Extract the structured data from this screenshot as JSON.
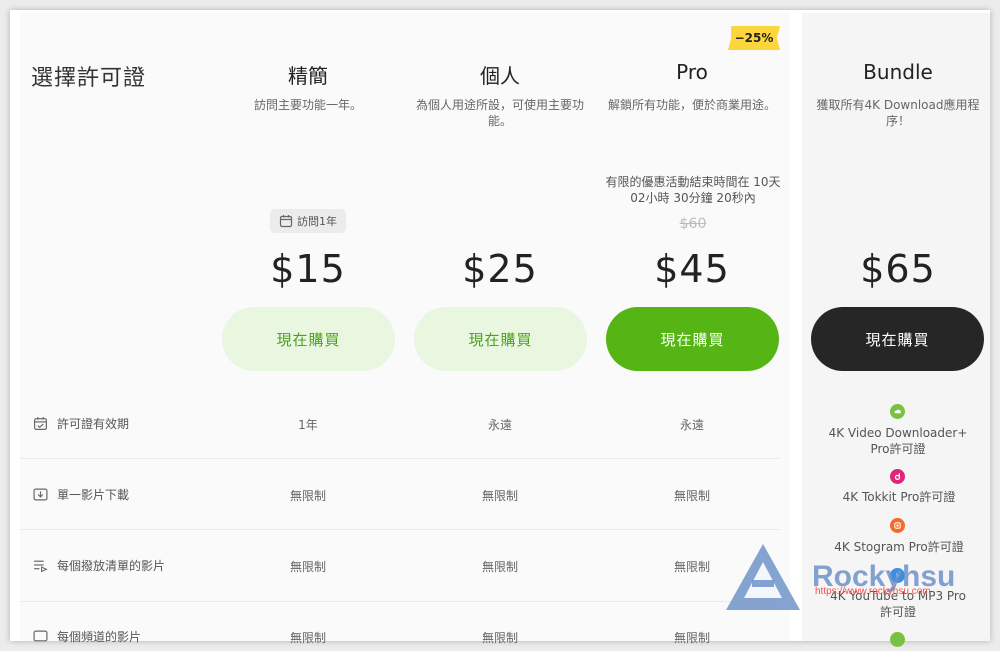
{
  "section_title": "選擇許可證",
  "plans": [
    {
      "name": "精簡",
      "desc": "訪問主要功能一年。",
      "price": "$15",
      "button": "現在購買"
    },
    {
      "name": "個人",
      "desc": "為個人用途所設，可使用主要功能。",
      "price": "$25",
      "button": "現在購買"
    },
    {
      "name": "Pro",
      "desc": "解鎖所有功能，便於商業用途。",
      "price": "$45",
      "button": "現在購買"
    },
    {
      "name": "Bundle",
      "desc": "獲取所有4K Download應用程序！",
      "price": "$65",
      "button": "現在購買"
    }
  ],
  "access_badge": "訪問1年",
  "discount_badge": "−25%",
  "promo_text": "有限的優惠活動結束時間在 10天 02小時 30分鐘 20秒內",
  "old_price": "$60",
  "features": [
    {
      "label": "許可證有效期",
      "icon": "calendar-icon",
      "values": [
        "1年",
        "永遠",
        "永遠"
      ]
    },
    {
      "label": "單一影片下載",
      "icon": "download-video-icon",
      "values": [
        "無限制",
        "無限制",
        "無限制"
      ]
    },
    {
      "label": "每個撥放清單的影片",
      "icon": "playlist-icon",
      "values": [
        "無限制",
        "無限制",
        "無限制"
      ]
    },
    {
      "label": "每個頻道的影片",
      "icon": "channel-icon",
      "values": [
        "無限制",
        "無限制",
        "無限制"
      ]
    }
  ],
  "bundle_items": [
    {
      "name": "4K Video Downloader+ Pro許可證",
      "color": "#7ac142"
    },
    {
      "name": "4K Tokkit Pro許可證",
      "color": "#e0257a"
    },
    {
      "name": "4K Stogram Pro許可證",
      "color": "#f26b2c"
    },
    {
      "name": "4K YouTube to MP3 Pro許可證",
      "color": "#3a8fe0"
    },
    {
      "name": "",
      "color": "#7ac142"
    }
  ],
  "watermark": {
    "brand": "Rockyhsu",
    "url": "https://www.rockyhsu.com"
  }
}
